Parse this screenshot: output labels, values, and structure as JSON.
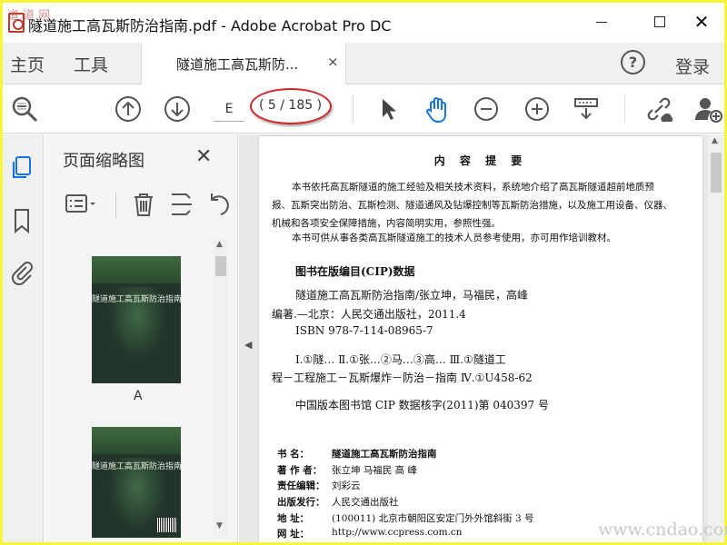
{
  "window": {
    "title": "隧道施工高瓦斯防治指南.pdf - Adobe Acrobat Pro DC",
    "close_glyph": "✕"
  },
  "tabs": {
    "home": "主页",
    "tools": "工具",
    "document": "隧道施工高瓦斯防...",
    "document_close": "×",
    "help": "?",
    "login": "登录"
  },
  "toolbar": {
    "page_input": "E",
    "page_count": "( 5 / 185 )",
    "icons": [
      "zoom-search-icon",
      "page-up-icon",
      "page-down-icon",
      "select-arrow-icon",
      "hand-icon",
      "zoom-out-icon",
      "zoom-in-icon",
      "scroll-mode-icon",
      "link-cloud-icon",
      "add-user-icon"
    ]
  },
  "rail": {
    "icons": [
      "page-thumbnails-icon",
      "bookmark-icon",
      "attachment-icon"
    ]
  },
  "thumbnails": {
    "title": "页面缩略图",
    "close": "✕",
    "items": [
      {
        "cover_title": "隧道施工高瓦斯防治指南",
        "label": "A"
      },
      {
        "cover_title": "隧道施工高瓦斯防治指南",
        "label": ""
      }
    ]
  },
  "page": {
    "heading": "内 容 提 要",
    "summary": [
      "本书依托高瓦斯隧道的施工经验及相关技术资料，系统地介绍了高瓦斯隧道超前地质预",
      "报、瓦斯突出防治、瓦斯检测、隧道通风及钻爆控制等瓦斯防治措施，以及施工用设备、仪器、",
      "机械和各项安全保障措施，内容简明实用，参照性强。",
      "本书可供从事各类高瓦斯隧道施工的技术人员参考使用，亦可用作培训教材。"
    ],
    "cip_title": "图书在版编目(CIP)数据",
    "cip_lines": [
      "隧道施工高瓦斯防治指南/张立坤，马福民，高峰",
      "编著.—北京：人民交通出版社，2011.4",
      "ISBN  978-7-114-08965-7",
      "Ⅰ.①隧…   Ⅱ.①张…②马…③高…   Ⅲ.①隧道工",
      "程－工程施工－瓦斯爆炸－防治－指南   Ⅳ.①U458-62",
      "中国版本图书馆 CIP 数据核字(2011)第 040397 号"
    ],
    "colophon": [
      {
        "key": "书      名：",
        "value": "隧道施工高瓦斯防治指南"
      },
      {
        "key": "著  作  者：",
        "value": "张立坤   马福民   高   峰"
      },
      {
        "key": "责任编辑：",
        "value": "刘彩云"
      },
      {
        "key": "出版发行：",
        "value": "人民交通出版社"
      },
      {
        "key": "地      址：",
        "value": "(100011) 北京市朝阳区安定门外外馆斜街 3 号"
      },
      {
        "key": "网      址：",
        "value": "http://www.ccpress.com.cn"
      }
    ]
  },
  "watermark": "www.cndao.com",
  "site_logo": "道 道 网"
}
